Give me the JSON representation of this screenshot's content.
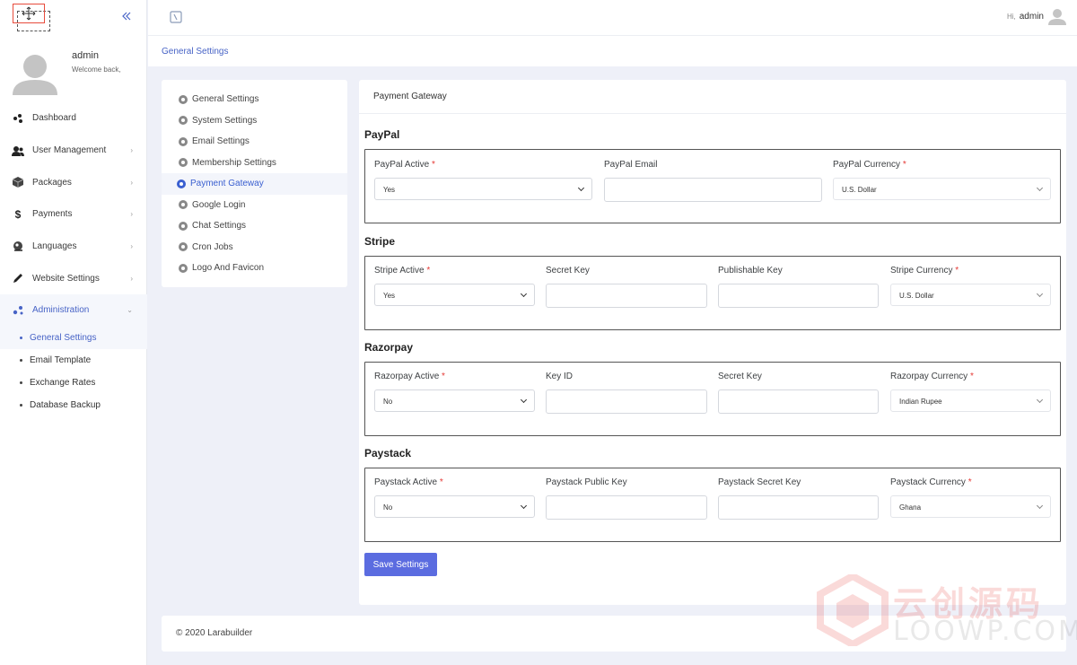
{
  "user": {
    "name": "admin",
    "welcome": "Welcome back,",
    "hi": "Hi,",
    "top_name": "admin"
  },
  "sidebar": {
    "items": [
      {
        "label": "Dashboard",
        "icon": "dashboard-icon",
        "chevron": ""
      },
      {
        "label": "User Management",
        "icon": "users-icon",
        "chevron": "›"
      },
      {
        "label": "Packages",
        "icon": "package-icon",
        "chevron": "›"
      },
      {
        "label": "Payments",
        "icon": "dollar-icon",
        "glyph": "$",
        "chevron": "›"
      },
      {
        "label": "Languages",
        "icon": "languages-icon",
        "chevron": "›"
      },
      {
        "label": "Website Settings",
        "icon": "pen-icon",
        "chevron": "›"
      },
      {
        "label": "Administration",
        "icon": "admin-icon",
        "chevron": "⌄"
      }
    ],
    "submenu": [
      {
        "label": "General Settings",
        "active": true
      },
      {
        "label": "Email Template"
      },
      {
        "label": "Exchange Rates"
      },
      {
        "label": "Database Backup"
      }
    ]
  },
  "breadcrumb": "General Settings",
  "settings_nav": [
    {
      "label": "General Settings"
    },
    {
      "label": "System Settings"
    },
    {
      "label": "Email Settings"
    },
    {
      "label": "Membership Settings"
    },
    {
      "label": "Payment Gateway",
      "active": true
    },
    {
      "label": "Google Login"
    },
    {
      "label": "Chat Settings"
    },
    {
      "label": "Cron Jobs"
    },
    {
      "label": "Logo And Favicon"
    }
  ],
  "card_title": "Payment Gateway",
  "sections": {
    "paypal": {
      "title": "PayPal",
      "active_label": "PayPal Active",
      "active_value": "Yes",
      "email_label": "PayPal Email",
      "email_value": "",
      "currency_label": "PayPal Currency",
      "currency_value": "U.S. Dollar"
    },
    "stripe": {
      "title": "Stripe",
      "active_label": "Stripe Active",
      "active_value": "Yes",
      "secret_label": "Secret Key",
      "secret_value": "",
      "publishable_label": "Publishable Key",
      "publishable_value": "",
      "currency_label": "Stripe Currency",
      "currency_value": "U.S. Dollar"
    },
    "razorpay": {
      "title": "Razorpay",
      "active_label": "Razorpay Active",
      "active_value": "No",
      "keyid_label": "Key ID",
      "keyid_value": "",
      "secret_label": "Secret Key",
      "secret_value": "",
      "currency_label": "Razorpay Currency",
      "currency_value": "Indian Rupee"
    },
    "paystack": {
      "title": "Paystack",
      "active_label": "Paystack Active",
      "active_value": "No",
      "public_label": "Paystack Public Key",
      "public_value": "",
      "secret_label": "Paystack Secret Key",
      "secret_value": "",
      "currency_label": "Paystack Currency",
      "currency_value": "Ghana"
    }
  },
  "required_mark": "*",
  "save_label": "Save Settings",
  "footer": "© 2020 Larabuilder",
  "watermark": {
    "line1": "云创源码",
    "line2": "LOOWP.COM"
  },
  "colors": {
    "accent": "#4763c6",
    "button": "#5b6ce0",
    "required": "#e53935"
  }
}
